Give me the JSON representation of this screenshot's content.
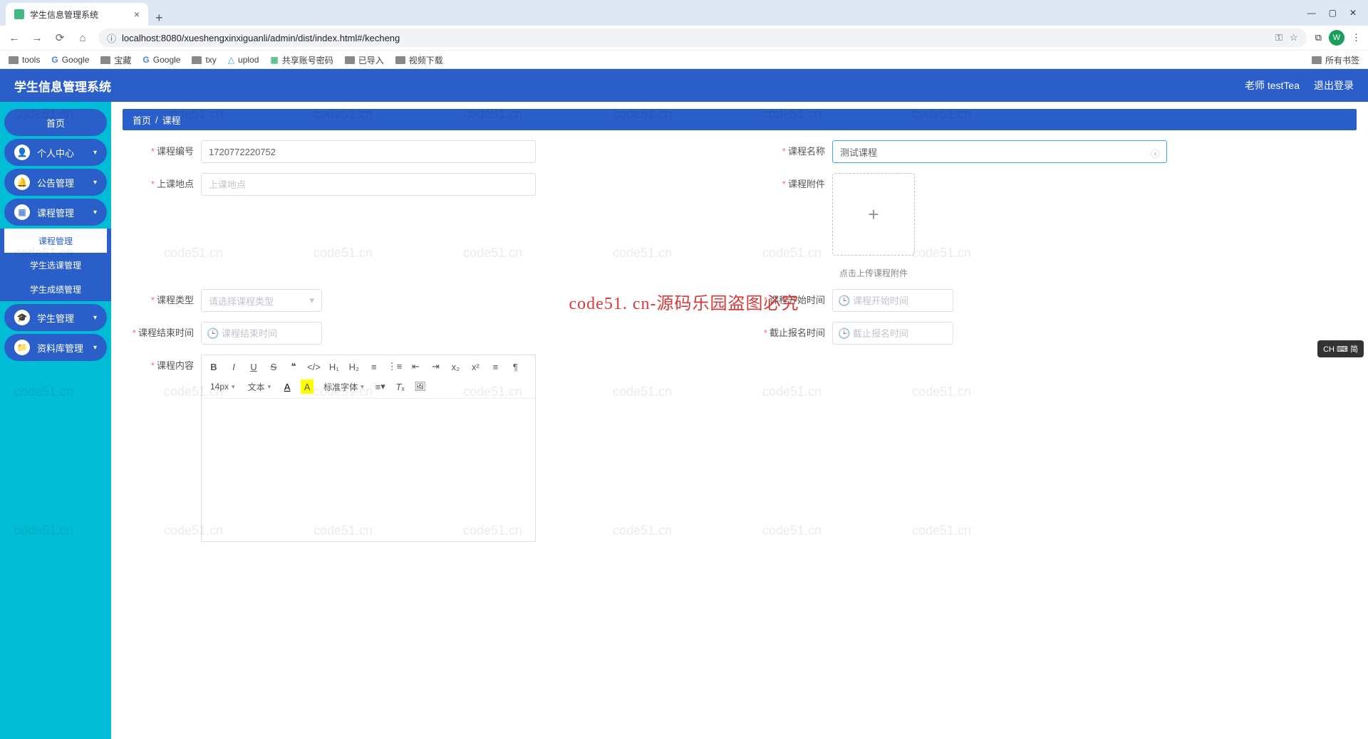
{
  "browser": {
    "tab_title": "学生信息管理系统",
    "url": "localhost:8080/xueshengxinxiguanli/admin/dist/index.html#/kecheng",
    "bookmarks": [
      "tools",
      "Google",
      "宝藏",
      "Google",
      "txy",
      "uplod",
      "共享账号密码",
      "已导入",
      "视频下载"
    ],
    "all_bookmarks": "所有书签",
    "avatar_letter": "W"
  },
  "header": {
    "title": "学生信息管理系统",
    "user": "老师 testTea",
    "logout": "退出登录"
  },
  "sidebar": {
    "home": "首页",
    "items": [
      {
        "label": "个人中心"
      },
      {
        "label": "公告管理"
      },
      {
        "label": "课程管理"
      },
      {
        "label": "学生管理"
      },
      {
        "label": "资料库管理"
      }
    ],
    "kecheng_sub": [
      "课程管理",
      "学生选课管理",
      "学生成绩管理"
    ]
  },
  "breadcrumb": {
    "home": "首页",
    "sep": "/",
    "current": "课程"
  },
  "form": {
    "course_id": {
      "label": "课程编号",
      "value": "1720772220752"
    },
    "course_name": {
      "label": "课程名称",
      "value": "测试课程"
    },
    "location": {
      "label": "上课地点",
      "placeholder": "上课地点"
    },
    "attachment": {
      "label": "课程附件",
      "hint": "点击上传课程附件"
    },
    "course_type": {
      "label": "课程类型",
      "placeholder": "请选择课程类型"
    },
    "start_time": {
      "label": "课程开始时间",
      "placeholder": "课程开始时间"
    },
    "end_time": {
      "label": "课程结束时间",
      "placeholder": "课程结束时间"
    },
    "deadline": {
      "label": "截止报名时间",
      "placeholder": "截止报名时间"
    },
    "content": {
      "label": "课程内容"
    }
  },
  "editor": {
    "font_size": "14px",
    "font_family_label": "文本",
    "std_font": "标准字体"
  },
  "ime": "CH ⌨ 简",
  "watermark_banner": "code51. cn-源码乐园盗图必究",
  "watermark_cell": "code51.cn"
}
